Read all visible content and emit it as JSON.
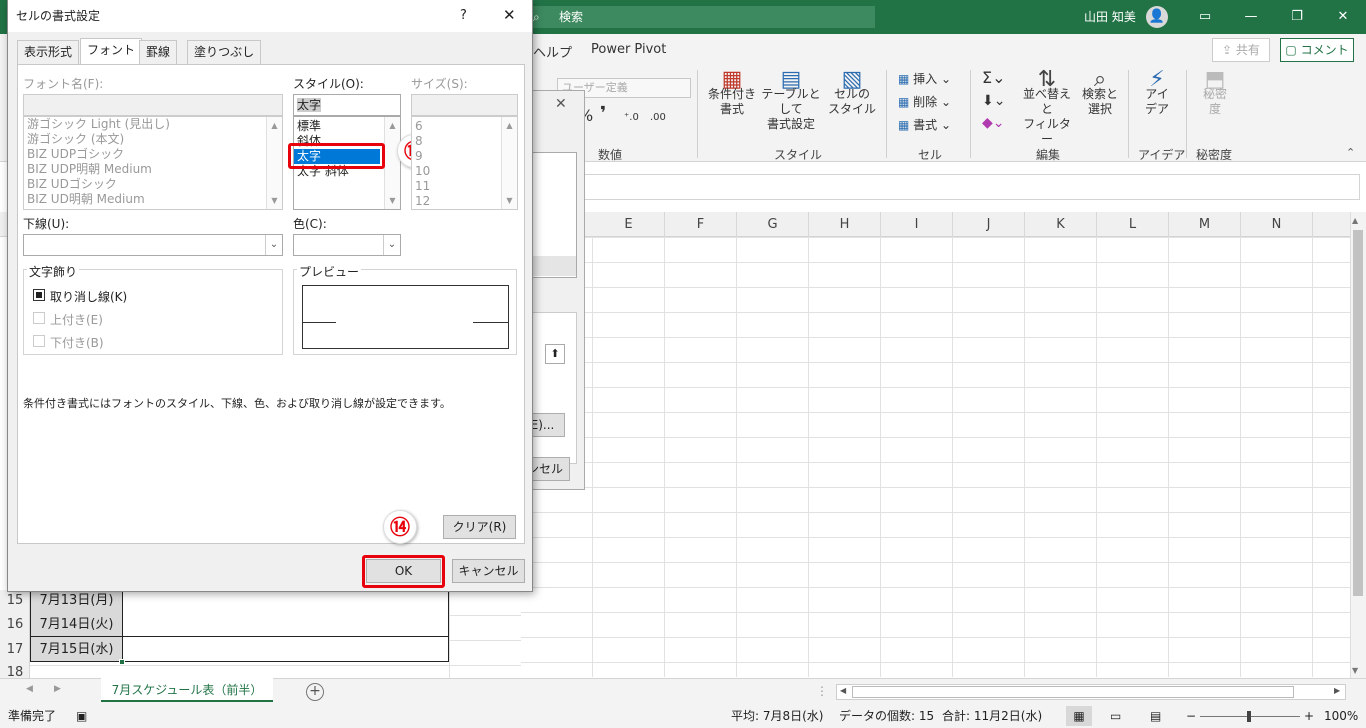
{
  "app": {
    "search_label": "検索",
    "user_name": "山田 知美",
    "tabs": [
      "ヘルプ",
      "Power Pivot"
    ],
    "share_label": "共有",
    "comment_label": "コメント"
  },
  "ribbon": {
    "number_format": "ユーザー定義",
    "groups": {
      "number": "数値",
      "style": "スタイル",
      "cells": "セル",
      "edit": "編集",
      "ideas": "アイデア",
      "sensitivity": "秘密度"
    },
    "buttons": {
      "conditional": [
        "条件付き",
        "書式"
      ],
      "table": [
        "テーブルとして",
        "書式設定"
      ],
      "cellstyle": [
        "セルの",
        "スタイル"
      ],
      "insert": "挿入",
      "delete": "削除",
      "format": "書式",
      "sort": [
        "並べ替えと",
        "フィルター"
      ],
      "find": [
        "検索と",
        "選択"
      ],
      "ideas": [
        "アイ",
        "デア"
      ],
      "sensitivity": [
        "秘密",
        "度"
      ]
    }
  },
  "grid": {
    "columns": [
      "E",
      "F",
      "G",
      "H",
      "I",
      "J",
      "K",
      "L",
      "M",
      "N"
    ],
    "rows": [
      {
        "num": "15",
        "date": "7月13日(月)"
      },
      {
        "num": "16",
        "date": "7月14日(火)"
      },
      {
        "num": "17",
        "date": "7月15日(水)"
      },
      {
        "num": "18",
        "date": ""
      }
    ]
  },
  "sheet_tab": "7月スケジュール表（前半）",
  "status": {
    "ready": "準備完了",
    "average": "平均: 7月8日(水)",
    "count": "データの個数: 15",
    "sum": "合計: 11月2日(水)",
    "zoom": "100%"
  },
  "background_dialog": {
    "button1": "E)...",
    "button2": "ンセル"
  },
  "dialog": {
    "title": "セルの書式設定",
    "help": "?",
    "tabs": [
      "表示形式",
      "フォント",
      "罫線",
      "塗りつぶし"
    ],
    "font_name_label": "フォント名(F):",
    "font_list": [
      "游ゴシック Light (見出し)",
      "游ゴシック (本文)",
      "BIZ UDPゴシック",
      "BIZ UDP明朝 Medium",
      "BIZ UDゴシック",
      "BIZ UD明朝 Medium"
    ],
    "style_label": "スタイル(O):",
    "style_value": "太字",
    "style_list": [
      "標準",
      "斜体",
      "太字",
      "太字 斜体"
    ],
    "size_label": "サイズ(S):",
    "size_list": [
      "6",
      "8",
      "9",
      "10",
      "11",
      "12"
    ],
    "underline_label": "下線(U):",
    "color_label": "色(C):",
    "effects_label": "文字飾り",
    "strikethrough_label": "取り消し線(K)",
    "superscript_label": "上付き(E)",
    "subscript_label": "下付き(B)",
    "preview_label": "プレビュー",
    "note": "条件付き書式にはフォントのスタイル、下線、色、および取り消し線が設定できます。",
    "clear_label": "クリア(R)",
    "ok_label": "OK",
    "cancel_label": "キャンセル"
  },
  "annotations": {
    "step13": "⑬",
    "step14": "⑭"
  },
  "colors": {
    "excel_green": "#217346",
    "highlight_red": "#e8000b",
    "selection_blue": "#0078d7"
  }
}
